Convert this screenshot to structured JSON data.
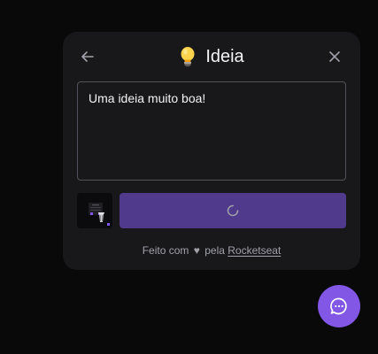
{
  "widget": {
    "title": "Ideia",
    "title_icon": "lightbulb-icon",
    "back_icon": "arrow-left-icon",
    "close_icon": "close-icon",
    "comment": {
      "value": "Uma ideia muito boa!"
    },
    "screenshot_icon": "screenshot-thumbnail",
    "submit_state": "loading",
    "submit_icon": "spinner-icon",
    "footer": {
      "prefix": "Feito com",
      "heart": "♥",
      "middle": "pela",
      "link": "Rocketseat"
    },
    "colors": {
      "panel": "#18181b",
      "accent": "#8257e5",
      "button_loading": "#4f3a8c",
      "border": "#52525b"
    }
  },
  "fab": {
    "icon": "chat-bubble-icon"
  }
}
